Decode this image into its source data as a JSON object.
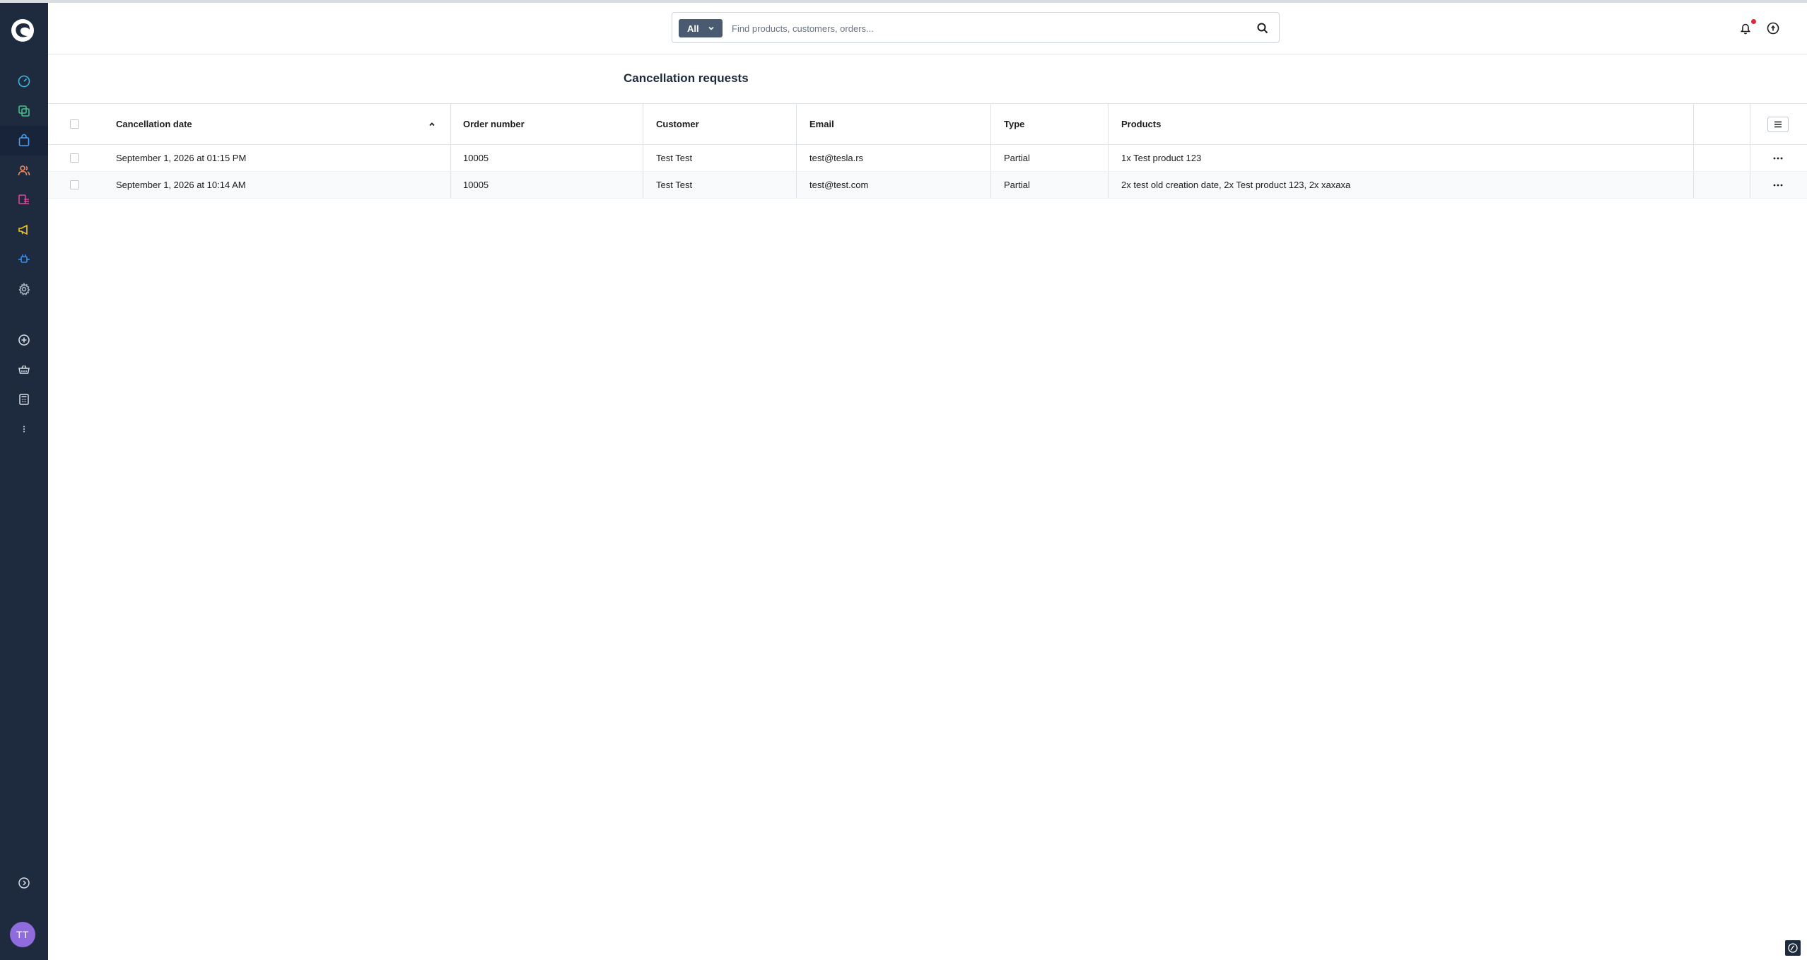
{
  "colors": {
    "sidebar_bg": "#1e2a3e",
    "search_type_button": "#4a5a70",
    "avatar": "#8f6bde",
    "notification_dot": "#e2263a"
  },
  "search": {
    "type_label": "All",
    "placeholder": "Find products, customers, orders...",
    "value": ""
  },
  "sidebar": {
    "items": [
      {
        "name": "dashboard",
        "icon": "gauge-icon"
      },
      {
        "name": "catalogues",
        "icon": "stack-icon"
      },
      {
        "name": "orders",
        "icon": "bag-icon"
      },
      {
        "name": "customers",
        "icon": "users-icon"
      },
      {
        "name": "content",
        "icon": "content-icon"
      },
      {
        "name": "marketing",
        "icon": "megaphone-icon"
      },
      {
        "name": "extensions",
        "icon": "plug-icon"
      },
      {
        "name": "settings",
        "icon": "gear-icon"
      },
      {
        "name": "add",
        "icon": "plus-circle-icon"
      },
      {
        "name": "shop",
        "icon": "basket-icon"
      },
      {
        "name": "calculator",
        "icon": "calculator-icon"
      },
      {
        "name": "more",
        "icon": "more-vertical-icon"
      }
    ],
    "avatar_initials": "TT"
  },
  "page": {
    "title": "Cancellation requests"
  },
  "table": {
    "columns": [
      "Cancellation date",
      "Order number",
      "Customer",
      "Email",
      "Type",
      "Products"
    ],
    "sorted_column": "Cancellation date",
    "sort_direction": "ascending",
    "rows": [
      {
        "cancellation_date": "September 1, 2026 at 01:15 PM",
        "order_number": "10005",
        "customer": "Test Test",
        "email": "test@tesla.rs",
        "type": "Partial",
        "products": "1x Test product 123"
      },
      {
        "cancellation_date": "September 1, 2026 at 10:14 AM",
        "order_number": "10005",
        "customer": "Test Test",
        "email": "test@test.com",
        "type": "Partial",
        "products": "2x test old creation date, 2x Test product 123, 2x xaxaxa"
      }
    ]
  }
}
